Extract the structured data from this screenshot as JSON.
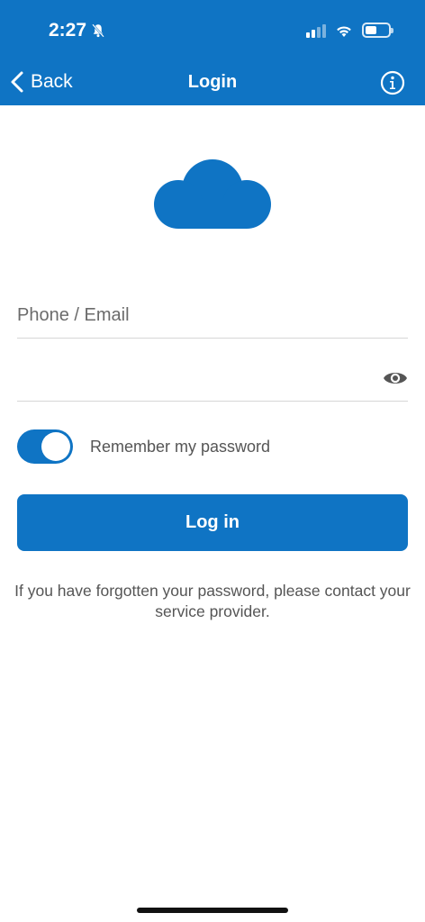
{
  "status_bar": {
    "time": "2:27",
    "mute_icon": "bell-slash-icon",
    "signal_icon": "cellular-signal-icon",
    "wifi_icon": "wifi-icon",
    "battery_icon": "battery-icon"
  },
  "nav": {
    "back_label": "Back",
    "title": "Login",
    "info_icon": "info-icon"
  },
  "logo": {
    "icon": "cloud-icon"
  },
  "form": {
    "email_placeholder": "Phone / Email",
    "email_value": "",
    "password_value": "",
    "password_toggle_icon": "eye-icon",
    "remember_label": "Remember my password",
    "remember_enabled": true,
    "login_label": "Log in"
  },
  "footer": {
    "forgot_text": "If you have forgotten your password, please contact your service provider."
  },
  "colors": {
    "brand": "#0f74c4",
    "background": "#ffffff",
    "text_secondary": "#555555"
  }
}
